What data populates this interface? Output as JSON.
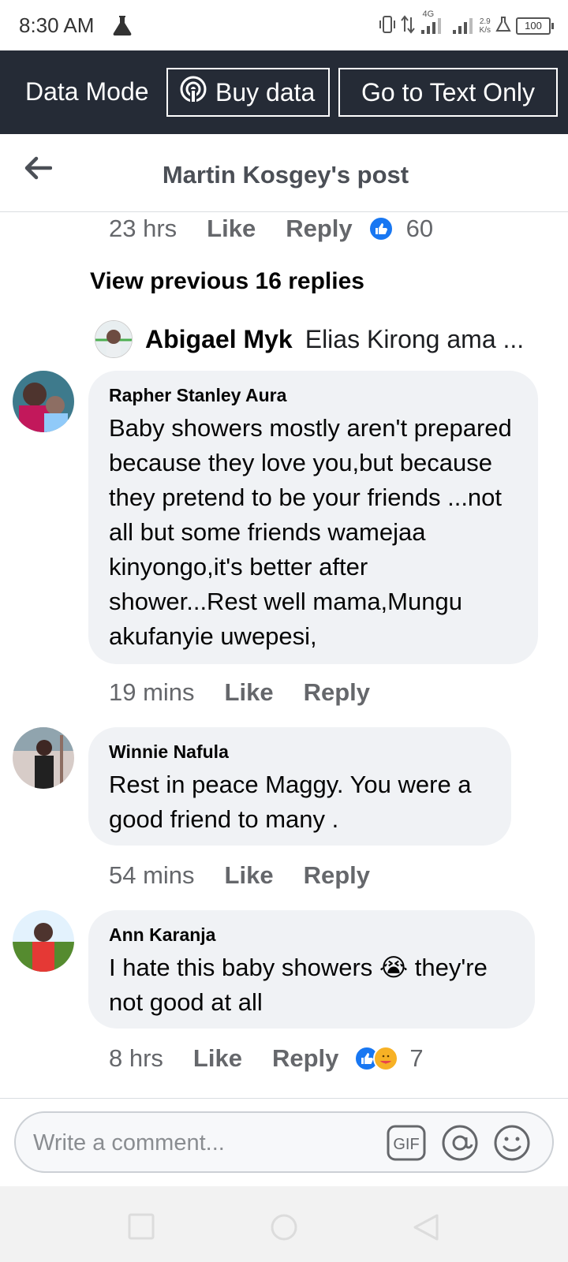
{
  "status_bar": {
    "time": "8:30 AM",
    "network": "4G",
    "speed": "2.9",
    "speed_unit": "K/s",
    "battery": "100"
  },
  "data_bar": {
    "mode_label": "Data Mode",
    "buy_label": "Buy data",
    "text_only_label": "Go to Text Only"
  },
  "header": {
    "title": "Martin Kosgey's post"
  },
  "top_meta": {
    "time": "23 hrs",
    "like": "Like",
    "reply": "Reply",
    "reaction_count": "60"
  },
  "view_previous": "View previous 16 replies",
  "reply_preview": {
    "name": "Abigael Myk",
    "text": "Elias Kirong ama ..."
  },
  "comments": [
    {
      "name": "Rapher Stanley Aura",
      "text": "Baby showers mostly aren't prepared because they love you,but because they pretend to be your friends ...not all but some friends wamejaa kinyongo,it's better after shower...Rest well mama,Mungu akufanyie uwepesi,",
      "time": "19 mins",
      "like": "Like",
      "reply": "Reply"
    },
    {
      "name": "Winnie Nafula",
      "text": "Rest in peace Maggy. You were a good friend to many .",
      "time": "54 mins",
      "like": "Like",
      "reply": "Reply"
    },
    {
      "name": "Ann Karanja",
      "text_before": "I hate this baby showers ",
      "emoji": "😭",
      "text_after": " they're not good at all",
      "time": "8 hrs",
      "like": "Like",
      "reply": "Reply",
      "reaction_count": "7"
    }
  ],
  "composer": {
    "placeholder": "Write a comment..."
  },
  "colors": {
    "dark_bar": "#252b36",
    "bubble": "#f0f2f5",
    "like_blue": "#1877f2",
    "meta_gray": "#65676b"
  }
}
